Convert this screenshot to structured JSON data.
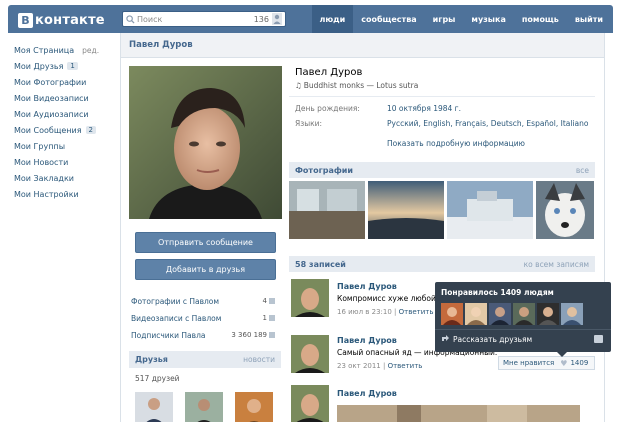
{
  "header": {
    "logo_letter": "В",
    "logo_text": "контакте",
    "search_placeholder": "Поиск",
    "search_count": "136",
    "nav": [
      {
        "label": "люди",
        "active": true
      },
      {
        "label": "сообщества",
        "active": false
      },
      {
        "label": "игры",
        "active": false
      },
      {
        "label": "музыка",
        "active": false
      },
      {
        "label": "помощь",
        "active": false
      },
      {
        "label": "выйти",
        "active": false
      }
    ]
  },
  "leftnav": {
    "items": [
      {
        "label": "Моя Страница",
        "extra": "ред."
      },
      {
        "label": "Мои Друзья",
        "badge": "1"
      },
      {
        "label": "Мои Фотографии"
      },
      {
        "label": "Мои Видеозаписи"
      },
      {
        "label": "Мои Аудиозаписи"
      },
      {
        "label": "Мои Сообщения",
        "badge": "2"
      },
      {
        "label": "Мои Группы"
      },
      {
        "label": "Мои Новости"
      },
      {
        "label": "Мои Закладки"
      },
      {
        "label": "Мои Настройки"
      }
    ]
  },
  "profile": {
    "header_name": "Павел Дуров",
    "name": "Павел Дуров",
    "status": "Buddhist monks — Lotus sutra",
    "birthday_label": "День рождения:",
    "birthday_value": "10 октября 1984 г.",
    "languages_label": "Языки:",
    "languages_value": "Русский, English, Français, Deutsch, Español, Italiano",
    "more_info": "Показать подробную информацию"
  },
  "actions": {
    "send_message": "Отправить сообщение",
    "add_friend": "Добавить в друзья"
  },
  "sidelinks": [
    {
      "label": "Фотографии с Павлом",
      "count": "4"
    },
    {
      "label": "Видеозаписи с Павлом",
      "count": "1"
    },
    {
      "label": "Подписчики Павла",
      "count": "3 360 189"
    }
  ],
  "friends": {
    "title": "Друзья",
    "right": "новости",
    "count": "517 друзей"
  },
  "photos": {
    "title": "Фотографии",
    "right": "все"
  },
  "wall": {
    "title": "58 записей",
    "right": "ко всем записям",
    "posts": [
      {
        "author": "Павел Дуров",
        "text": "Компромисс хуже любой из альтернатив.",
        "date": "16 июл в 23:10",
        "action": "Ответить"
      },
      {
        "author": "Павел Дуров",
        "text": "Самый опасный яд — информационный.",
        "date": "23 окт 2011",
        "action": "Ответить",
        "like_label": "Мне нравится",
        "like_count": "1409"
      },
      {
        "author": "Павел Дуров"
      }
    ]
  },
  "tooltip": {
    "title": "Понравилось 1409 людям",
    "share": "Рассказать друзьям"
  },
  "colors": {
    "brand": "#4e729a",
    "link": "#2b587a",
    "section_bg": "#e6ebf1",
    "tooltip_bg": "#34414f"
  }
}
